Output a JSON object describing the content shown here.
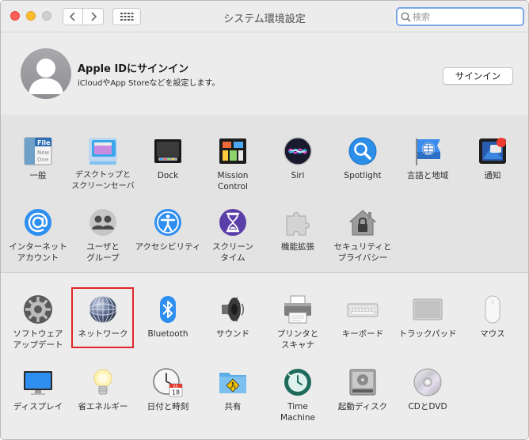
{
  "window": {
    "title": "システム環境設定"
  },
  "search": {
    "placeholder": "検索"
  },
  "apple_id": {
    "title": "Apple IDにサインイン",
    "subtitle": "iCloudやApp Storeなどを設定します。",
    "signin_label": "サインイン"
  },
  "icons": {
    "back": "chevron-left-icon",
    "forward": "chevron-right-icon",
    "grid": "grid-icon",
    "search": "search-icon"
  },
  "colors": {
    "highlight": "#e0262b",
    "search_focus": "#7aa7e6"
  },
  "panes_personal": [
    {
      "label": "一般"
    },
    {
      "label": "デスクトップと\nスクリーンセーバ"
    },
    {
      "label": "Dock"
    },
    {
      "label": "Mission\nControl"
    },
    {
      "label": "Siri"
    },
    {
      "label": "Spotlight"
    },
    {
      "label": "言語と地域"
    },
    {
      "label": "通知"
    },
    {
      "label": "インターネット\nアカウント"
    },
    {
      "label": "ユーザと\nグループ"
    },
    {
      "label": "アクセシビリティ"
    },
    {
      "label": "スクリーン\nタイム"
    },
    {
      "label": "機能拡張"
    },
    {
      "label": "セキュリティと\nプライバシー"
    }
  ],
  "panes_hardware": [
    {
      "label": "ソフトウェア\nアップデート"
    },
    {
      "label": "ネットワーク",
      "selected": true
    },
    {
      "label": "Bluetooth"
    },
    {
      "label": "サウンド"
    },
    {
      "label": "プリンタと\nスキャナ"
    },
    {
      "label": "キーボード"
    },
    {
      "label": "トラックパッド"
    },
    {
      "label": "マウス"
    },
    {
      "label": "ディスプレイ"
    },
    {
      "label": "省エネルギー"
    },
    {
      "label": "日付と時刻"
    },
    {
      "label": "共有"
    },
    {
      "label": "Time\nMachine"
    },
    {
      "label": "起動ディスク"
    },
    {
      "label": "CDとDVD"
    }
  ],
  "calendar_icon": {
    "month": "JUL",
    "day": "18"
  },
  "general_icon": {
    "label": "File",
    "lines": [
      "New",
      "One"
    ]
  }
}
